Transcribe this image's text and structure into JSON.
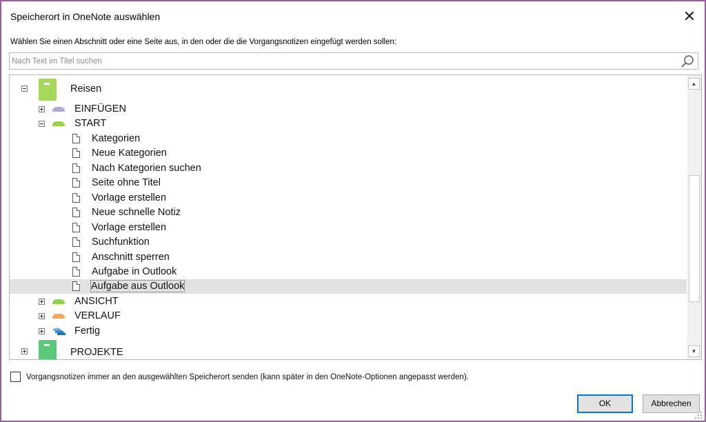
{
  "dialog": {
    "title": "Speicherort in OneNote auswählen",
    "close_glyph": "✕",
    "instruction": "Wählen Sie einen Abschnitt oder eine Seite aus, in den oder die die Vorgangsnotizen eingefügt werden sollen:",
    "search_placeholder": "Nach Text im Titel suchen",
    "search_value": ""
  },
  "tree": {
    "notebooks": [
      {
        "label": "Reisen",
        "color": "#a6d85b",
        "expanded": true,
        "sections": [
          {
            "label": "EINFÜGEN",
            "color": "#b4a7e0",
            "expanded": false
          },
          {
            "label": "START",
            "color": "#9bd24f",
            "expanded": true,
            "pages": [
              "Kategorien",
              "Neue Kategorien",
              "Nach Kategorien suchen",
              "Seite ohne Titel",
              "Vorlage erstellen",
              "Neue schnelle Notiz",
              "Vorlage erstellen",
              "Suchfunktion",
              "Anschnitt sperren",
              "Aufgabe in Outlook",
              "Aufgabe aus Outlook"
            ],
            "selected_page": "Aufgabe aus Outlook"
          },
          {
            "label": "ANSICHT",
            "color": "#8fd14f",
            "expanded": false
          },
          {
            "label": "VERLAUF",
            "color": "#f5a65b",
            "expanded": false
          },
          {
            "label": "Fertig",
            "color": "#3d8fd0",
            "expanded": false
          }
        ]
      },
      {
        "label": "PROJEKTE",
        "color": "#5ac878",
        "expanded": false
      }
    ]
  },
  "footer": {
    "checkbox_label": "Vorgangsnotizen immer an den ausgewählten Speicherort senden (kann später in den OneNote-Optionen angepasst werden).",
    "checkbox_checked": false,
    "ok_label": "OK",
    "cancel_label": "Abbrechen"
  },
  "theme": {
    "frame_color": "#9b5ba6",
    "ok_focus_color": "#0078d7",
    "selection_color": "#e1e1e1"
  }
}
